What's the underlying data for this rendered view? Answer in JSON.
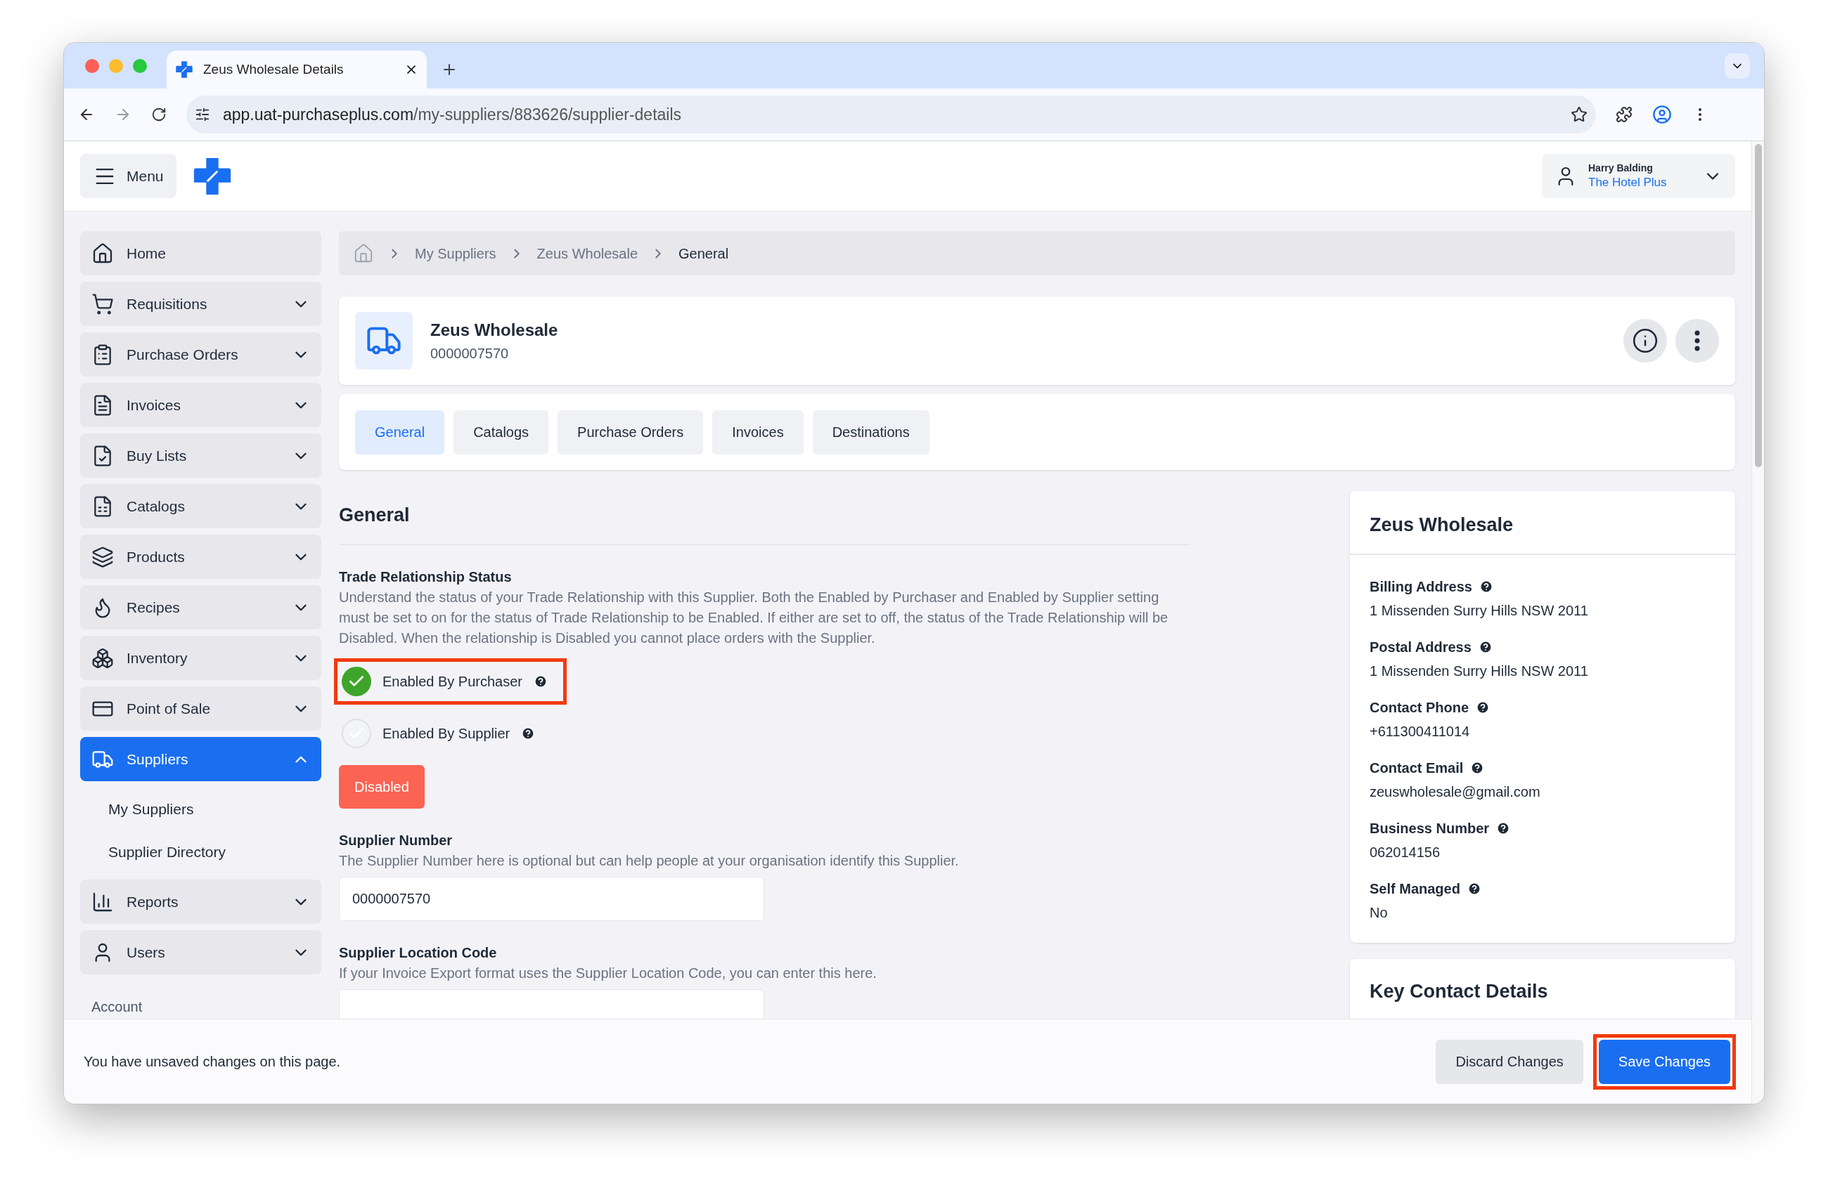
{
  "browser": {
    "tab_title": "Zeus Wholesale Details",
    "url_host": "app.uat-purchaseplus.com",
    "url_path": "/my-suppliers/883626/supplier-details"
  },
  "header": {
    "menu_label": "Menu",
    "user_name": "Harry Balding",
    "organisation": "The Hotel Plus"
  },
  "sidebar": {
    "items": [
      {
        "label": "Home",
        "kind": "link",
        "selected": false
      },
      {
        "label": "Requisitions",
        "kind": "group",
        "expanded": false,
        "selected": false
      },
      {
        "label": "Purchase Orders",
        "kind": "group",
        "expanded": false,
        "selected": false
      },
      {
        "label": "Invoices",
        "kind": "group",
        "expanded": false,
        "selected": false
      },
      {
        "label": "Buy Lists",
        "kind": "group",
        "expanded": false,
        "selected": false
      },
      {
        "label": "Catalogs",
        "kind": "group",
        "expanded": false,
        "selected": false
      },
      {
        "label": "Products",
        "kind": "group",
        "expanded": false,
        "selected": false
      },
      {
        "label": "Recipes",
        "kind": "group",
        "expanded": false,
        "selected": false
      },
      {
        "label": "Inventory",
        "kind": "group",
        "expanded": false,
        "selected": false
      },
      {
        "label": "Point of Sale",
        "kind": "group",
        "expanded": false,
        "selected": false
      },
      {
        "label": "Suppliers",
        "kind": "group",
        "expanded": true,
        "selected": true,
        "children": [
          {
            "label": "My Suppliers"
          },
          {
            "label": "Supplier Directory"
          }
        ]
      },
      {
        "label": "Reports",
        "kind": "group",
        "expanded": false,
        "selected": false
      },
      {
        "label": "Users",
        "kind": "group",
        "expanded": false,
        "selected": false
      }
    ],
    "section_label": "Account"
  },
  "breadcrumb": [
    "My Suppliers",
    "Zeus Wholesale",
    "General"
  ],
  "supplier": {
    "name": "Zeus Wholesale",
    "number": "0000007570"
  },
  "tabs": [
    {
      "label": "General",
      "selected": true
    },
    {
      "label": "Catalogs",
      "selected": false
    },
    {
      "label": "Purchase Orders",
      "selected": false
    },
    {
      "label": "Invoices",
      "selected": false
    },
    {
      "label": "Destinations",
      "selected": false
    }
  ],
  "general": {
    "heading": "General",
    "trade_title": "Trade Relationship Status",
    "trade_description": "Understand the status of your Trade Relationship with this Supplier. Both the Enabled by Purchaser and Enabled by Supplier setting must be set to on for the status of Trade Relationship to be Enabled. If either are set to off, the status of the Trade Relationship will be Disabled. When the relationship is Disabled you cannot place orders with the Supplier.",
    "toggles": [
      {
        "label": "Enabled By Purchaser",
        "checked": true,
        "highlighted": true
      },
      {
        "label": "Enabled By Supplier",
        "checked": false,
        "highlighted": false
      }
    ],
    "status": {
      "label": "Disabled",
      "kind": "disabled"
    },
    "fields": [
      {
        "label": "Supplier Number",
        "description": "The Supplier Number here is optional but can help people at your organisation identify this Supplier.",
        "value": "0000007570"
      },
      {
        "label": "Supplier Location Code",
        "description": "If your Invoice Export format uses the Supplier Location Code, you can enter this here."
      }
    ]
  },
  "details_card": {
    "title": "Zeus Wholesale",
    "fields": [
      {
        "label": "Billing Address",
        "value": "1 Missenden Surry Hills NSW 2011"
      },
      {
        "label": "Postal Address",
        "value": "1 Missenden Surry Hills NSW 2011"
      },
      {
        "label": "Contact Phone",
        "value": "+611300411014"
      },
      {
        "label": "Contact Email",
        "value": "zeuswholesale@gmail.com"
      },
      {
        "label": "Business Number",
        "value": "062014156"
      },
      {
        "label": "Self Managed",
        "value": "No"
      }
    ]
  },
  "key_contact": {
    "title": "Key Contact Details"
  },
  "footer": {
    "message": "You have unsaved changes on this page.",
    "buttons": [
      {
        "label": "Discard Changes",
        "kind": "secondary",
        "highlighted": false
      },
      {
        "label": "Save Changes",
        "kind": "primary",
        "highlighted": true
      }
    ]
  }
}
